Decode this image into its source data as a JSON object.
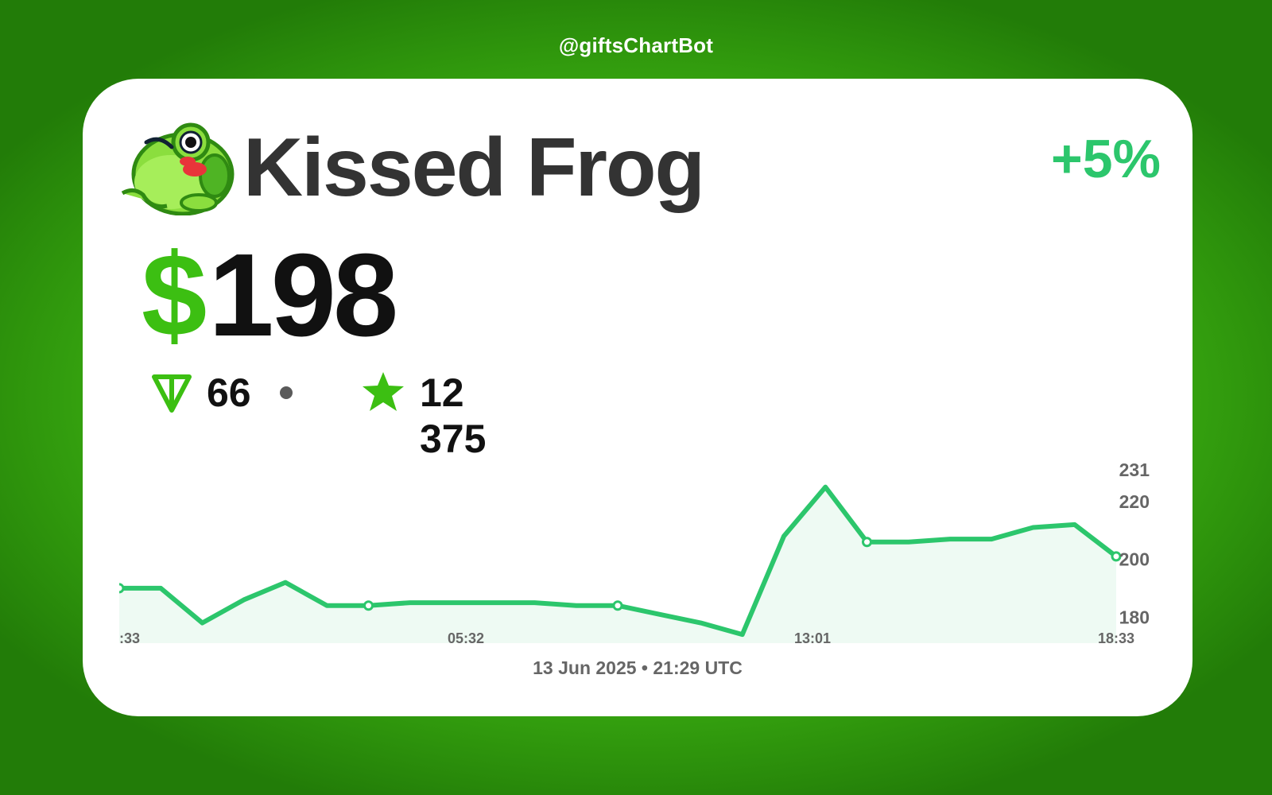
{
  "header": {
    "bot_handle": "@giftsChartBot"
  },
  "gift": {
    "name": "Kissed Frog",
    "icon": "kissed-frog-icon",
    "change": "+5%",
    "price_symbol": "$",
    "price": "198",
    "ton_icon": "ton-icon",
    "ton_price": "66",
    "star_icon": "star-icon",
    "stars_price": "12 375"
  },
  "colors": {
    "background": "#28a30d",
    "accent_green": "#3cbf12",
    "positive": "#2cc66c",
    "line": "#2cc66c",
    "area": "#eefaf3"
  },
  "chart_data": {
    "type": "area",
    "x_ticks": [
      ":33",
      "05:32",
      "13:01",
      "18:33"
    ],
    "y_ticks": [
      180,
      200,
      220,
      "231"
    ],
    "ylim": [
      171,
      237
    ],
    "values": [
      190,
      190,
      178,
      186,
      192,
      184,
      184,
      185,
      185,
      185,
      185,
      184,
      184,
      181,
      178,
      174,
      208,
      225,
      206,
      206,
      207,
      207,
      211,
      212,
      201
    ],
    "markers": [
      0,
      6,
      12,
      18,
      24
    ],
    "grid": false,
    "legend": "none",
    "timestamp": "13 Jun 2025 • 21:29 UTC"
  }
}
